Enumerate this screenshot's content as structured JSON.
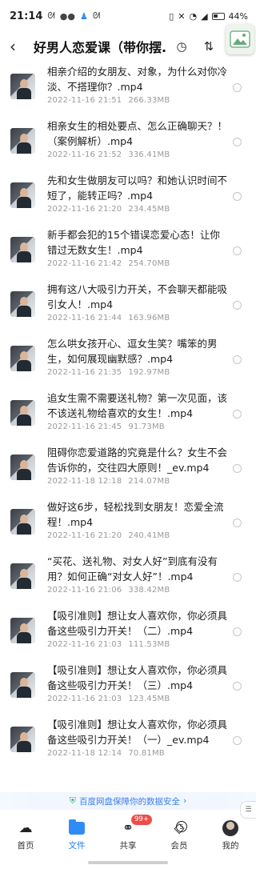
{
  "status_bar": {
    "time": "21:14",
    "battery": "44%"
  },
  "header": {
    "title": "好男人恋爱课（带你摆..."
  },
  "files": [
    {
      "name": "相亲介绍的女朋友、对象，为什么对你冷淡、不搭理你？.mp4",
      "date": "2022-11-16 21:51",
      "size": "266.33MB"
    },
    {
      "name": "相亲女生的相处要点、怎么正确聊天？！（案例解析）.mp4",
      "date": "2022-11-16 21:52",
      "size": "336.41MB"
    },
    {
      "name": "先和女生做朋友可以吗？和她认识时间不短了，能转正吗？.mp4",
      "date": "2022-11-16 21:20",
      "size": "234.45MB"
    },
    {
      "name": "新手都会犯的15个错误恋爱心态！让你错过无数女生！.mp4",
      "date": "2022-11-16 21:42",
      "size": "254.70MB"
    },
    {
      "name": "拥有这八大吸引力开关，不会聊天都能吸引女人！.mp4",
      "date": "2022-11-16 21:44",
      "size": "163.96MB"
    },
    {
      "name": "怎么哄女孩开心、逗女生笑？嘴笨的男生，如何展现幽默感？.mp4",
      "date": "2022-11-16 21:35",
      "size": "192.97MB"
    },
    {
      "name": "追女生需不需要送礼物？第一次见面，该不该送礼物给喜欢的女生！.mp4",
      "date": "2022-11-16 21:45",
      "size": "91.73MB"
    },
    {
      "name": "阻碍你恋爱道路的究竟是什么？女生不会告诉你的，交往四大原则！_ev.mp4",
      "date": "2022-11-18 12:18",
      "size": "214.07MB"
    },
    {
      "name": "做好这6步，轻松找到女朋友！恋爱全流程！.mp4",
      "date": "2022-11-16 21:20",
      "size": "240.41MB"
    },
    {
      "name": "“买花、送礼物、对女人好”到底有没有用？如何正确“对女人好”！.mp4",
      "date": "2022-11-16 21:06",
      "size": "338.42MB"
    },
    {
      "name": "【吸引准则】想让女人喜欢你，你必须具备这些吸引力开关！（二）.mp4",
      "date": "2022-11-16 21:03",
      "size": "111.53MB"
    },
    {
      "name": "【吸引准则】想让女人喜欢你，你必须具备这些吸引力开关！（三）.mp4",
      "date": "2022-11-16 21:03",
      "size": "123.45MB"
    },
    {
      "name": "【吸引准则】想让女人喜欢你，你必须具备这些吸引力开关！（一）_ev.mp4",
      "date": "2022-11-18 12:14",
      "size": "70.81MB"
    }
  ],
  "safety_banner": "百度网盘保障你的数据安全",
  "nav": {
    "home": "首页",
    "files": "文件",
    "share": "共享",
    "share_badge": "99+",
    "member": "会员",
    "member_badge": "5",
    "mine": "我的"
  },
  "colors": {
    "accent": "#1d7df0",
    "folder": "#2f8cf5",
    "badge": "#f04b4b",
    "safety_text": "#3e7fe6"
  }
}
